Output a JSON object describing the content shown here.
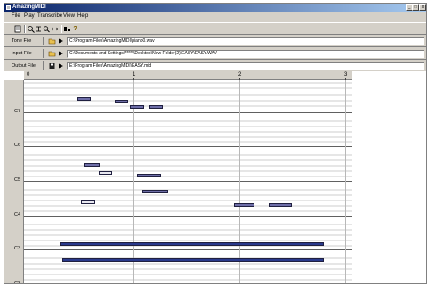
{
  "window": {
    "title": "AmazingMIDI",
    "controls": [
      "_",
      "□",
      "x"
    ]
  },
  "menu": [
    "File",
    "Play",
    "Transcribe",
    "View",
    "Help"
  ],
  "toolbar": {
    "buttons": [
      "transcribe-icon",
      "zoom-in-icon",
      "zoom-out-icon",
      "zoom-vertical-icon",
      "zoom-horizontal-icon",
      "settings-icon",
      "help-icon"
    ]
  },
  "files": [
    {
      "label": "Tone File",
      "path": "C:\\Program Files\\AmazingMIDI\\piano0.wav"
    },
    {
      "label": "Input File",
      "path": "C:\\Documents and Settings\\*****\\Desktop\\New Folder(2)\\EASY\\EASY.WAV"
    },
    {
      "label": "Output File",
      "path": "E:\\Program Files\\AmazingMIDI\\EASY.mid"
    }
  ],
  "ruler": {
    "labels": [
      "0",
      "1",
      "2",
      "3"
    ]
  },
  "keys": {
    "labels": [
      "C7",
      "C6",
      "C5",
      "C4",
      "C3",
      "C2"
    ]
  },
  "colors": {
    "note_fill": "#6e6ea8",
    "note_selected": "#e8e8f0",
    "note_strong": "#2a3a8c",
    "lane": "#e6e6e6",
    "title_gradient_start": "#0a246a"
  },
  "notes": [
    {
      "start": 0.47,
      "end": 0.6,
      "pitch": "C7+5",
      "strength": "mid"
    },
    {
      "start": 0.82,
      "end": 0.95,
      "pitch": "C7+4",
      "strength": "mid"
    },
    {
      "start": 0.97,
      "end": 1.1,
      "pitch": "C7+2",
      "strength": "mid"
    },
    {
      "start": 1.15,
      "end": 1.28,
      "pitch": "C7+2",
      "strength": "mid"
    },
    {
      "start": 0.53,
      "end": 0.68,
      "pitch": "C5+6",
      "strength": "mid"
    },
    {
      "start": 0.67,
      "end": 0.8,
      "pitch": "C5+3",
      "strength": "light"
    },
    {
      "start": 1.03,
      "end": 1.26,
      "pitch": "C5+2",
      "strength": "mid"
    },
    {
      "start": 1.08,
      "end": 1.33,
      "pitch": "C4+9",
      "strength": "mid"
    },
    {
      "start": 0.5,
      "end": 0.64,
      "pitch": "C4+5",
      "strength": "light"
    },
    {
      "start": 1.95,
      "end": 2.14,
      "pitch": "C4+4",
      "strength": "mid"
    },
    {
      "start": 2.28,
      "end": 2.5,
      "pitch": "C4+4",
      "strength": "mid"
    },
    {
      "start": 0.3,
      "end": 2.8,
      "pitch": "C3+2",
      "strength": "strong"
    },
    {
      "start": 0.33,
      "end": 2.8,
      "pitch": "C2+9",
      "strength": "strong"
    }
  ]
}
